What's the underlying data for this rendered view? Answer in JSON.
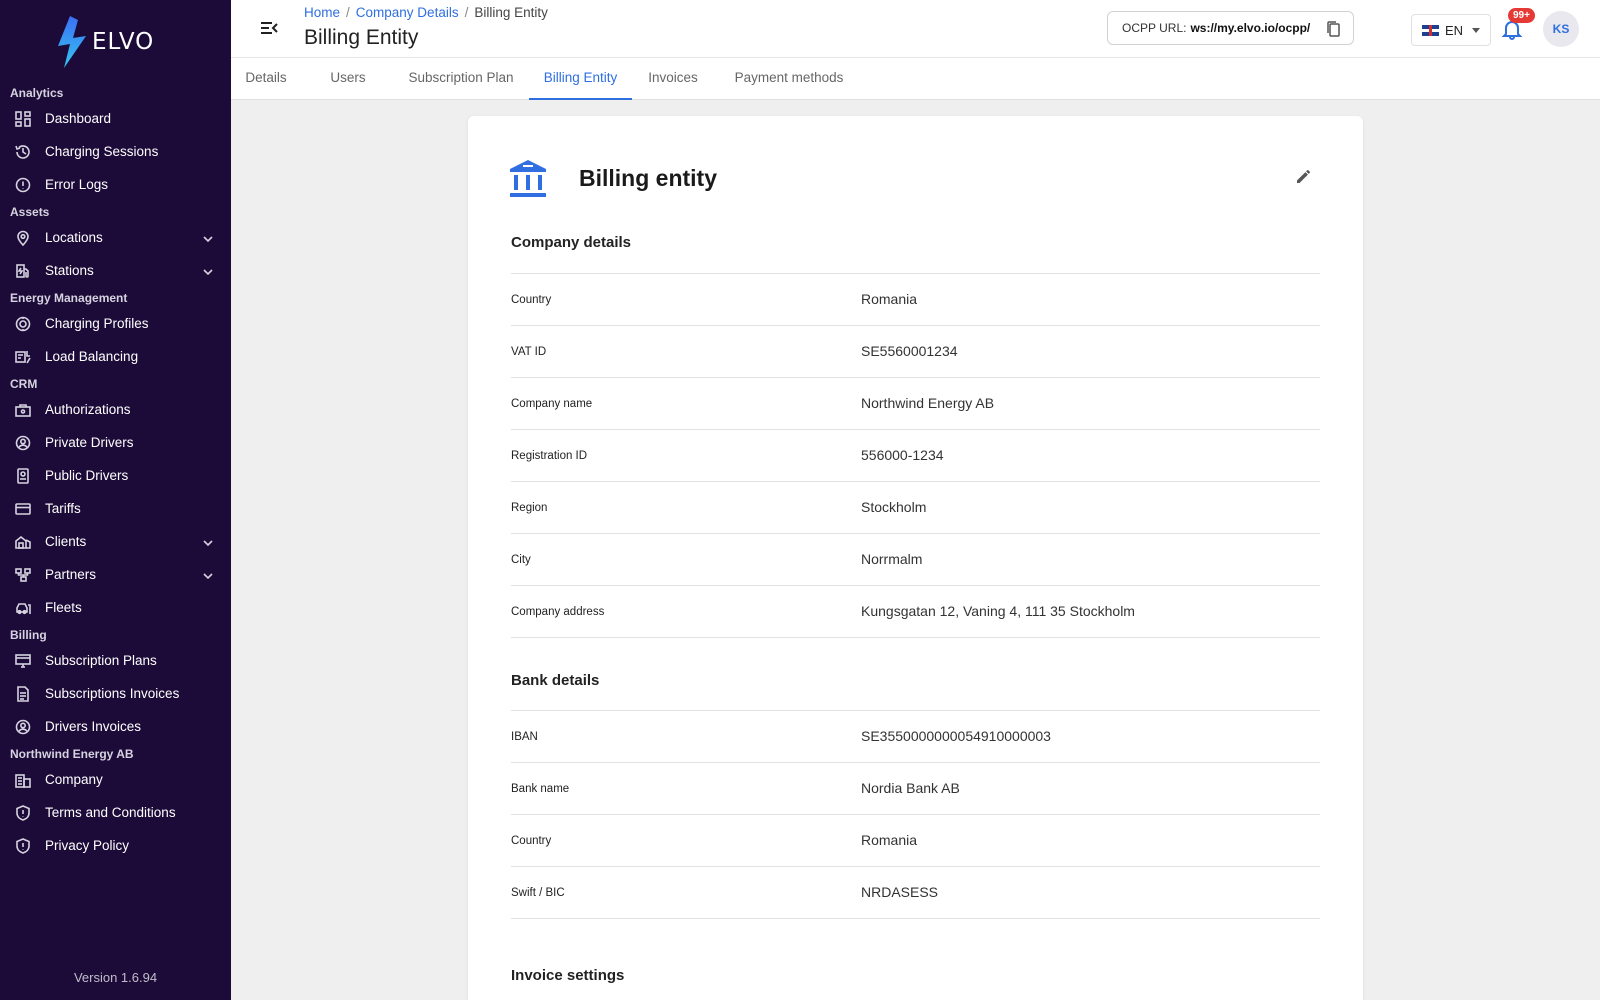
{
  "app": {
    "brand": "ELVO",
    "version": "Version 1.6.94"
  },
  "sidebar": {
    "sections": [
      {
        "title": "Analytics",
        "items": [
          {
            "label": "Dashboard",
            "icon": "dashboard-icon"
          },
          {
            "label": "Charging Sessions",
            "icon": "history-icon"
          },
          {
            "label": "Error Logs",
            "icon": "alert-circle-icon"
          }
        ]
      },
      {
        "title": "Assets",
        "items": [
          {
            "label": "Locations",
            "icon": "location-pin-icon",
            "expandable": true
          },
          {
            "label": "Stations",
            "icon": "ev-station-icon",
            "expandable": true
          }
        ]
      },
      {
        "title": "Energy Management",
        "items": [
          {
            "label": "Charging Profiles",
            "icon": "charging-profile-icon"
          },
          {
            "label": "Load Balancing",
            "icon": "load-balancing-icon"
          }
        ]
      },
      {
        "title": "CRM",
        "items": [
          {
            "label": "Authorizations",
            "icon": "authorization-icon"
          },
          {
            "label": "Private Drivers",
            "icon": "user-circle-icon"
          },
          {
            "label": "Public Drivers",
            "icon": "id-badge-icon"
          },
          {
            "label": "Tariffs",
            "icon": "credit-card-icon"
          },
          {
            "label": "Clients",
            "icon": "clients-icon",
            "expandable": true
          },
          {
            "label": "Partners",
            "icon": "partners-icon",
            "expandable": true
          },
          {
            "label": "Fleets",
            "icon": "fleet-car-icon"
          }
        ]
      },
      {
        "title": "Billing",
        "items": [
          {
            "label": "Subscription Plans",
            "icon": "subscription-plan-icon"
          },
          {
            "label": "Subscriptions Invoices",
            "icon": "document-icon"
          },
          {
            "label": "Drivers Invoices",
            "icon": "user-circle-icon"
          }
        ]
      },
      {
        "title": "Northwind Energy AB",
        "items": [
          {
            "label": "Company",
            "icon": "building-icon"
          },
          {
            "label": "Terms and Conditions",
            "icon": "shield-icon"
          },
          {
            "label": "Privacy Policy",
            "icon": "shield-icon"
          }
        ]
      }
    ]
  },
  "header": {
    "breadcrumb": [
      "Home",
      "Company Details",
      "Billing Entity"
    ],
    "title": "Billing Entity",
    "ocpp_label": "OCPP URL:",
    "ocpp_value": "ws://my.elvo.io/ocpp/",
    "language": "EN",
    "notification_badge": "99+",
    "user_initials": "KS"
  },
  "tabs": [
    {
      "label": "Details",
      "active": false
    },
    {
      "label": "Users",
      "active": false
    },
    {
      "label": "Subscription Plan",
      "active": false
    },
    {
      "label": "Billing Entity",
      "active": true
    },
    {
      "label": "Invoices",
      "active": false
    },
    {
      "label": "Payment methods",
      "active": false
    }
  ],
  "card": {
    "title": "Billing entity",
    "company_details": {
      "title": "Company details",
      "rows": [
        {
          "label": "Country",
          "value": "Romania"
        },
        {
          "label": "VAT ID",
          "value": "SE5560001234"
        },
        {
          "label": "Company name",
          "value": "Northwind Energy AB"
        },
        {
          "label": "Registration ID",
          "value": "556000-1234"
        },
        {
          "label": "Region",
          "value": "Stockholm"
        },
        {
          "label": "City",
          "value": "Norrmalm"
        },
        {
          "label": "Company address",
          "value": "Kungsgatan 12, Vaning 4, 111 35 Stockholm"
        }
      ]
    },
    "bank_details": {
      "title": "Bank details",
      "rows": [
        {
          "label": "IBAN",
          "value": "SE3550000000054910000003"
        },
        {
          "label": "Bank name",
          "value": "Nordia Bank AB"
        },
        {
          "label": "Country",
          "value": "Romania"
        },
        {
          "label": "Swift / BIC",
          "value": "NRDASESS"
        }
      ]
    },
    "invoice_settings": {
      "title": "Invoice settings"
    }
  },
  "colors": {
    "sidebar_bg": "#1c0b38",
    "accent": "#2f6fe0",
    "badge": "#e53935"
  }
}
